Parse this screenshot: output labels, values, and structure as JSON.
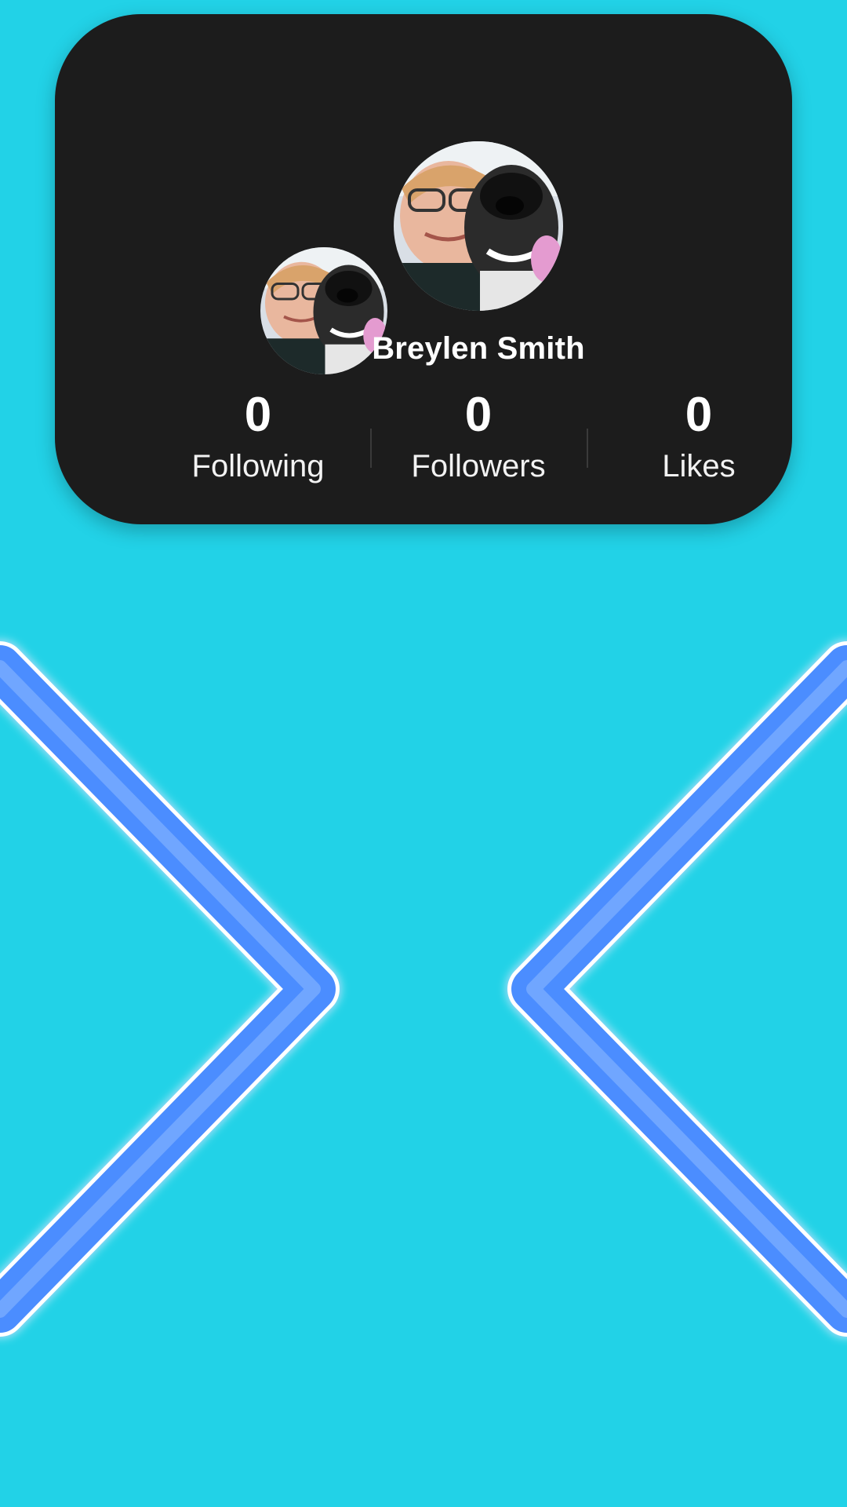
{
  "profile": {
    "name": "Breylen Smith",
    "stats": [
      {
        "value": "0",
        "label": "Following"
      },
      {
        "value": "0",
        "label": "Followers"
      },
      {
        "value": "0",
        "label": "Likes"
      }
    ]
  },
  "colors": {
    "background": "#22D2E7",
    "card": "#1C1C1C",
    "neon": "#4C8DFF"
  },
  "icons": {
    "left_chevron": "chevron-right-icon",
    "right_chevron": "chevron-left-icon"
  }
}
